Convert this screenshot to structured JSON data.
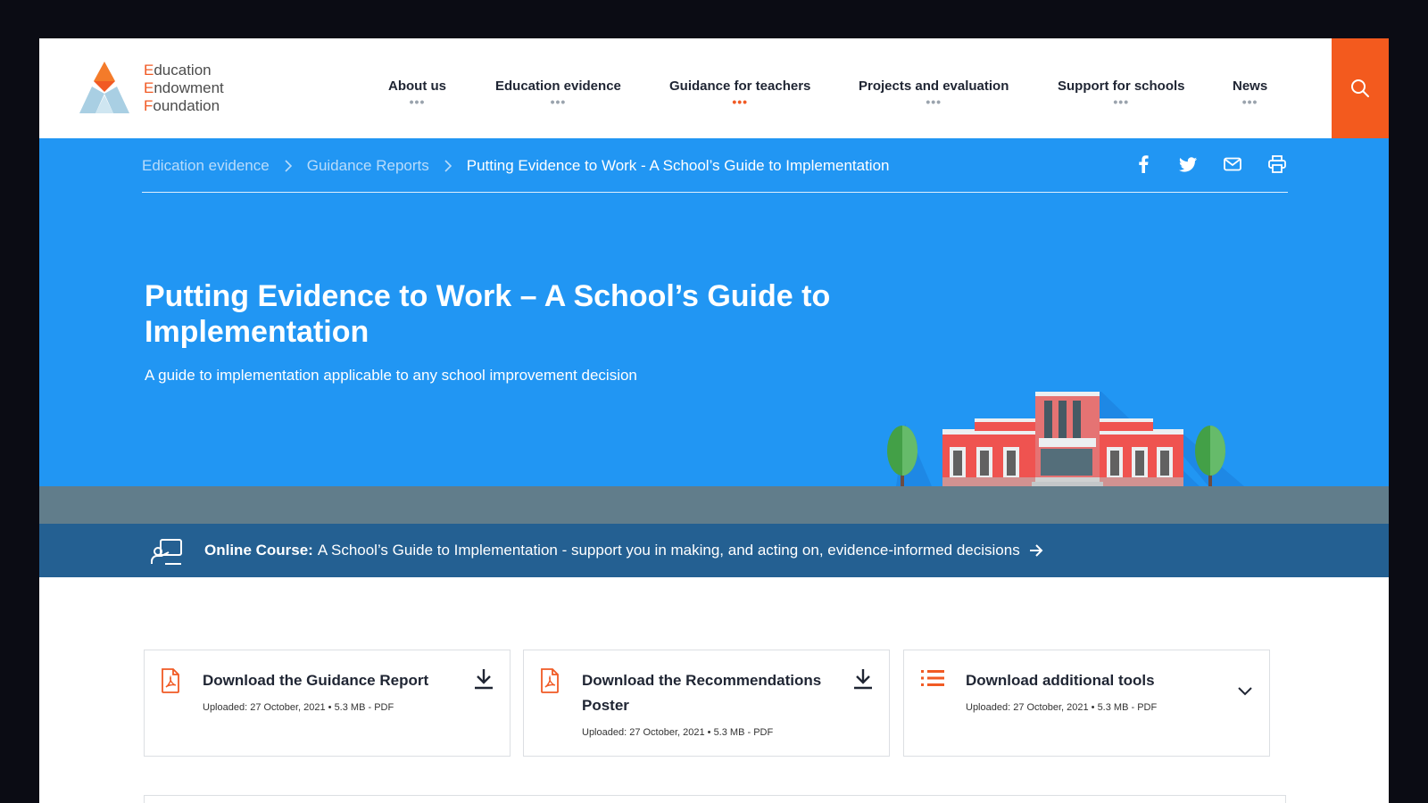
{
  "colors": {
    "accent": "#f35a1e",
    "hero_blue": "#2196f3",
    "banner_blue": "#246092",
    "ground_gray": "#617d8b",
    "text_dark": "#1f2533"
  },
  "logo": {
    "line1": "Education",
    "line2": "Endowment",
    "line3": "Foundation"
  },
  "nav": {
    "items": [
      {
        "label": "About us",
        "dots": "•••"
      },
      {
        "label": "Education evidence",
        "dots": "•••"
      },
      {
        "label": "Guidance for teachers",
        "dots": "•••",
        "active": true
      },
      {
        "label": "Projects and evaluation",
        "dots": "•••"
      },
      {
        "label": "Support for schools",
        "dots": "•••"
      },
      {
        "label": "News",
        "dots": "•••"
      }
    ],
    "search_icon": "search-icon"
  },
  "breadcrumb": {
    "items": [
      "Edication evidence",
      "Guidance Reports"
    ],
    "current": "Putting Evidence to Work - A School’s Guide to Implementation"
  },
  "share": {
    "icons": [
      "facebook-icon",
      "twitter-icon",
      "email-icon",
      "print-icon"
    ]
  },
  "hero": {
    "title": "Putting Evidence to Work – A School’s Guide to Implementation",
    "subtitle": "A guide to implementation applicable to any school improvement decision"
  },
  "course": {
    "label": "Online Course:",
    "text": "A School’s Guide to Implementation - support you in making, and acting on, evidence-informed decisions"
  },
  "cards": [
    {
      "title": "Download the Guidance Report",
      "meta": "Uploaded: 27 October, 2021 • 5.3 MB - PDF",
      "icon": "pdf-icon",
      "action": "download-icon"
    },
    {
      "title": "Download the Recommendations Poster",
      "meta": "Uploaded: 27 October, 2021 • 5.3 MB - PDF",
      "icon": "pdf-icon",
      "action": "download-icon"
    },
    {
      "title": "Download additional tools",
      "meta": "Uploaded: 27 October, 2021 • 5.3 MB - PDF",
      "icon": "list-icon",
      "action": "chevron-down-icon"
    }
  ]
}
